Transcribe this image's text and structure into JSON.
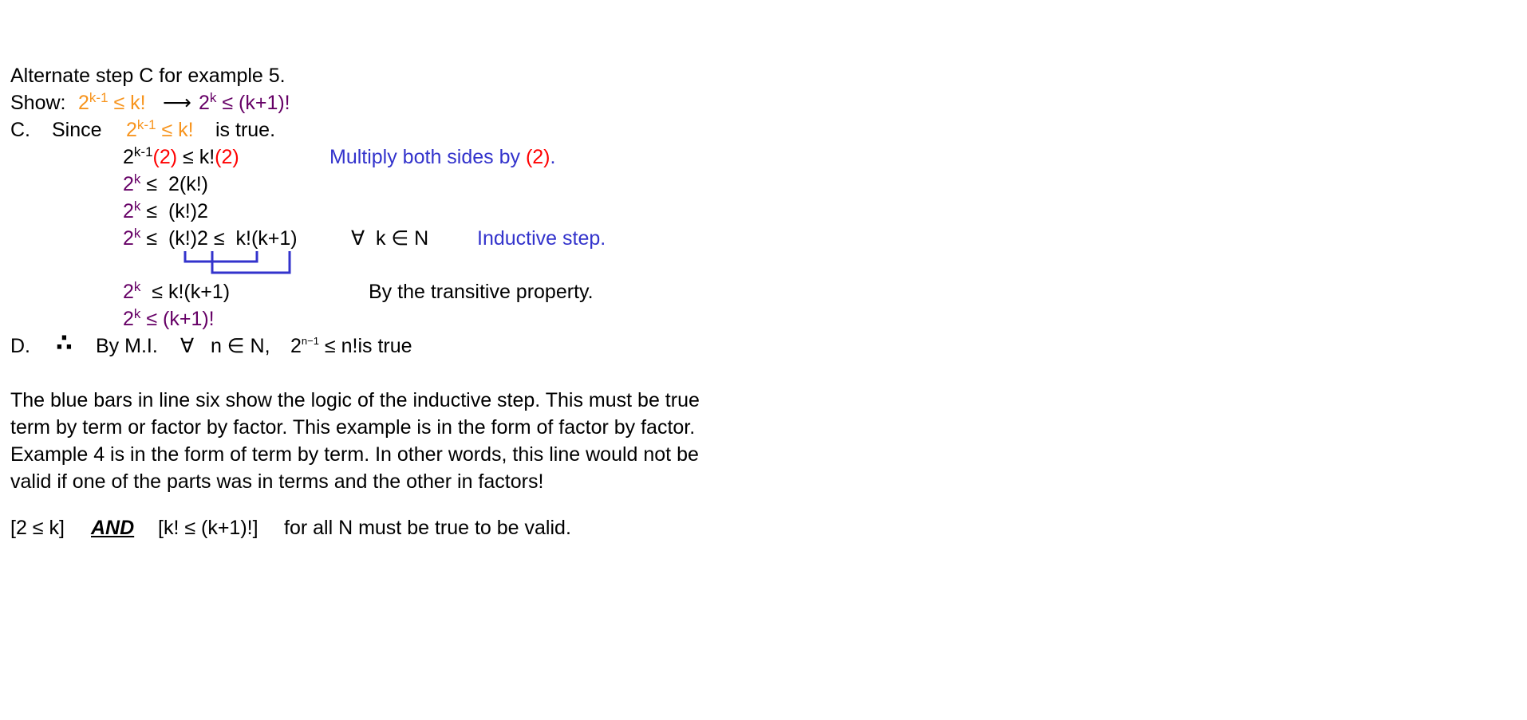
{
  "colors": {
    "purple": "#660066",
    "orange": "#f7941d",
    "red": "#ff0000",
    "blue": "#3333cc",
    "bracket": "#3333cc"
  },
  "title": "Alternate step C for example 5.",
  "show_line": {
    "label": "Show: ",
    "lhs_base": "2",
    "lhs_exp": "k-1",
    "lhs_rel": " ≤ k!",
    "arrow": "⟶",
    "rhs_base": "2",
    "rhs_exp": "k",
    "rhs_rel": " ≤ (k+1)!"
  },
  "step_c": {
    "label": "C.",
    "since": "Since",
    "base": "2",
    "exp": "k-1",
    "rel": " ≤ k!",
    "tail": "is true."
  },
  "steps": [
    {
      "base": "2",
      "exp": "k-1",
      "part1": "(2)",
      "part2": " ≤ k!",
      "part3": "(2)",
      "note_main": "Multiply both sides by ",
      "note_highlight": "(2)",
      "note_end": "."
    },
    {
      "base": "2",
      "exp": "k",
      "rest": " ≤  2(k!)"
    },
    {
      "base": "2",
      "exp": "k",
      "rest": " ≤  (k!)2"
    },
    {
      "base": "2",
      "exp": "k",
      "rest": " ≤  (k!)2 ≤  k!(k+1)",
      "quant": "∀  k ∈ N",
      "note": "Inductive step."
    },
    {
      "base": "2",
      "exp": "k",
      "rest": "  ≤ k!(k+1)",
      "note": "By the transitive property."
    },
    {
      "base": "2",
      "exp": "k",
      "rest": " ≤ (k+1)!"
    }
  ],
  "step_d": {
    "label": "D.",
    "therefore": "∴",
    "text1": "By M.I.",
    "quant": "∀   n ∈ N,",
    "base": "2",
    "exp": "n−1",
    "rel": " ≤ n!",
    "tail": "is true"
  },
  "paragraph": [
    "The blue bars in line six show the logic of the inductive step.  This must be true",
    "term by term or factor by factor.  This example is in the form of factor by factor.",
    "Example 4 is in the form of term by term.  In other words, this line would not be",
    "valid if one of the parts was in terms and the other in factors!"
  ],
  "conclusion": {
    "part1": "[2 ≤ k]",
    "and": "AND",
    "part2": "[k! ≤ (k+1)!]",
    "tail": "for all N must be true to be valid."
  }
}
